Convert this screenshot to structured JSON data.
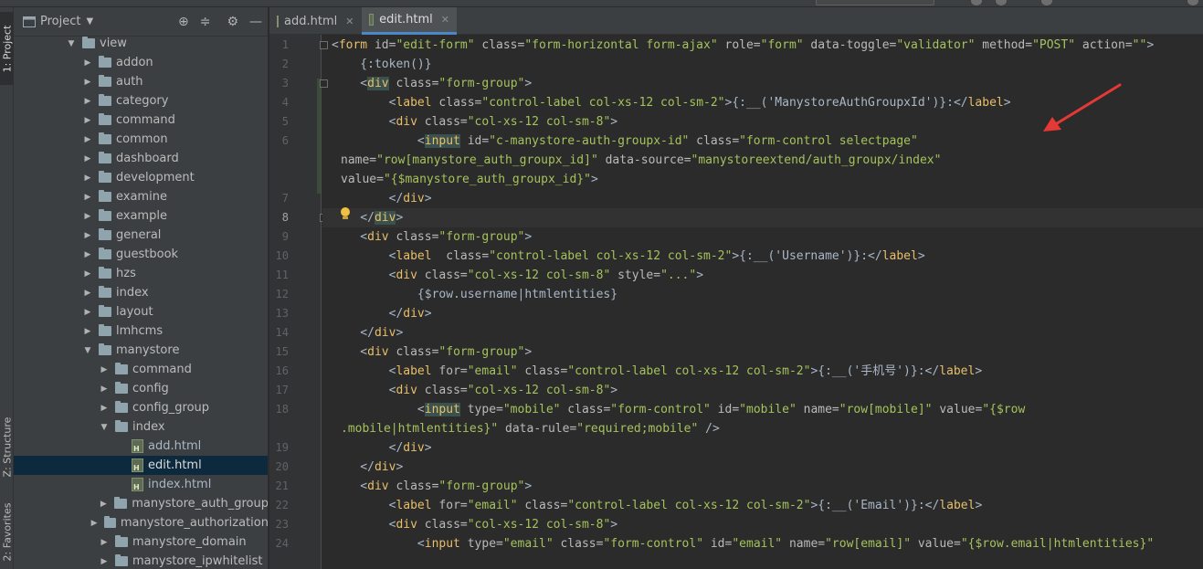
{
  "left_tabs": [
    {
      "label": "1: Project"
    },
    {
      "label": "Z: Structure"
    },
    {
      "label": "2: Favorites"
    }
  ],
  "project": {
    "title": "Project",
    "tree": [
      {
        "label": "view",
        "type": "folder",
        "depth": 0,
        "expanded": true
      },
      {
        "label": "addon",
        "type": "folder",
        "depth": 1
      },
      {
        "label": "auth",
        "type": "folder",
        "depth": 1
      },
      {
        "label": "category",
        "type": "folder",
        "depth": 1
      },
      {
        "label": "command",
        "type": "folder",
        "depth": 1
      },
      {
        "label": "common",
        "type": "folder",
        "depth": 1
      },
      {
        "label": "dashboard",
        "type": "folder",
        "depth": 1
      },
      {
        "label": "development",
        "type": "folder",
        "depth": 1
      },
      {
        "label": "examine",
        "type": "folder",
        "depth": 1
      },
      {
        "label": "example",
        "type": "folder",
        "depth": 1
      },
      {
        "label": "general",
        "type": "folder",
        "depth": 1
      },
      {
        "label": "guestbook",
        "type": "folder",
        "depth": 1
      },
      {
        "label": "hzs",
        "type": "folder",
        "depth": 1
      },
      {
        "label": "index",
        "type": "folder",
        "depth": 1
      },
      {
        "label": "layout",
        "type": "folder",
        "depth": 1
      },
      {
        "label": "lmhcms",
        "type": "folder",
        "depth": 1
      },
      {
        "label": "manystore",
        "type": "folder",
        "depth": 1,
        "expanded": true
      },
      {
        "label": "command",
        "type": "folder",
        "depth": 2
      },
      {
        "label": "config",
        "type": "folder",
        "depth": 2
      },
      {
        "label": "config_group",
        "type": "folder",
        "depth": 2
      },
      {
        "label": "index",
        "type": "folder",
        "depth": 2,
        "expanded": true
      },
      {
        "label": "add.html",
        "type": "file",
        "depth": 3
      },
      {
        "label": "edit.html",
        "type": "file",
        "depth": 3,
        "selected": true
      },
      {
        "label": "index.html",
        "type": "file",
        "depth": 3
      },
      {
        "label": "manystore_auth_group",
        "type": "folder",
        "depth": 2
      },
      {
        "label": "manystore_authorization",
        "type": "folder",
        "depth": 2
      },
      {
        "label": "manystore_domain",
        "type": "folder",
        "depth": 2
      },
      {
        "label": "manystore_ipwhitelist",
        "type": "folder",
        "depth": 2
      }
    ]
  },
  "tabs": [
    {
      "label": "add.html",
      "active": false
    },
    {
      "label": "edit.html",
      "active": true
    }
  ],
  "editor": {
    "current_line": 8,
    "lines": [
      {
        "n": "1",
        "segs": [
          [
            "t-plain",
            "<"
          ],
          [
            "t-tag",
            "form"
          ],
          [
            "t-attr",
            " id="
          ],
          [
            "t-val",
            "\"edit-form\""
          ],
          [
            "t-attr",
            " class="
          ],
          [
            "t-val",
            "\"form-horizontal form-ajax\""
          ],
          [
            "t-attr",
            " role="
          ],
          [
            "t-val",
            "\"form\""
          ],
          [
            "t-attr",
            " data-toggle="
          ],
          [
            "t-val",
            "\"validator\""
          ],
          [
            "t-attr",
            " method="
          ],
          [
            "t-val",
            "\"POST\""
          ],
          [
            "t-attr",
            " action="
          ],
          [
            "t-val",
            "\"\""
          ],
          [
            "t-plain",
            ">"
          ]
        ]
      },
      {
        "n": "2",
        "segs": [
          [
            "t-plain",
            "    {:token()}"
          ]
        ]
      },
      {
        "n": "3",
        "segs": [
          [
            "t-plain",
            "    <"
          ],
          [
            "t-tag t-tagbg",
            "div"
          ],
          [
            "t-attr",
            " class="
          ],
          [
            "t-val",
            "\"form-group\""
          ],
          [
            "t-plain",
            ">"
          ]
        ]
      },
      {
        "n": "4",
        "segs": [
          [
            "t-plain",
            "        <"
          ],
          [
            "t-tag",
            "label"
          ],
          [
            "t-attr",
            " class="
          ],
          [
            "t-val",
            "\"control-label col-xs-12 col-sm-2\""
          ],
          [
            "t-plain",
            ">{:__('ManystoreAuthGroupxId')}:</"
          ],
          [
            "t-tag",
            "label"
          ],
          [
            "t-plain",
            ">"
          ]
        ]
      },
      {
        "n": "5",
        "segs": [
          [
            "t-plain",
            "        <"
          ],
          [
            "t-tag",
            "div"
          ],
          [
            "t-attr",
            " class="
          ],
          [
            "t-val",
            "\"col-xs-12 col-sm-8\""
          ],
          [
            "t-plain",
            ">"
          ]
        ]
      },
      {
        "n": "6",
        "segs": [
          [
            "t-plain",
            "            <"
          ],
          [
            "t-tag t-hl",
            "input"
          ],
          [
            "t-attr",
            " id="
          ],
          [
            "t-val",
            "\"c-manystore-auth-groupx-id\""
          ],
          [
            "t-attr",
            " class="
          ],
          [
            "t-val",
            "\"form-control selectpage\""
          ]
        ]
      },
      {
        "n": "",
        "segs": [
          [
            "t-attr",
            "name="
          ],
          [
            "t-val",
            "\"row[manystore_auth_groupx_id]\""
          ],
          [
            "t-attr",
            " data-source="
          ],
          [
            "t-val",
            "\"manystoreextend/auth_groupx/index\""
          ]
        ]
      },
      {
        "n": "",
        "segs": [
          [
            "t-attr",
            "value="
          ],
          [
            "t-val",
            "\"{$manystore_auth_groupx_id}\""
          ],
          [
            "t-plain",
            ">"
          ]
        ]
      },
      {
        "n": "7",
        "segs": [
          [
            "t-plain",
            "        </"
          ],
          [
            "t-tag",
            "div"
          ],
          [
            "t-plain",
            ">"
          ]
        ]
      },
      {
        "n": "8",
        "segs": [
          [
            "t-plain",
            "    </"
          ],
          [
            "t-tag t-tagbg",
            "div"
          ],
          [
            "t-plain",
            ">"
          ]
        ]
      },
      {
        "n": "9",
        "segs": [
          [
            "t-plain",
            "    <"
          ],
          [
            "t-tag",
            "div"
          ],
          [
            "t-attr",
            " class="
          ],
          [
            "t-val",
            "\"form-group\""
          ],
          [
            "t-plain",
            ">"
          ]
        ]
      },
      {
        "n": "10",
        "segs": [
          [
            "t-plain",
            "        <"
          ],
          [
            "t-tag",
            "label"
          ],
          [
            "t-attr",
            "  class="
          ],
          [
            "t-val",
            "\"control-label col-xs-12 col-sm-2\""
          ],
          [
            "t-plain",
            ">{:__('Username')}:</"
          ],
          [
            "t-tag",
            "label"
          ],
          [
            "t-plain",
            ">"
          ]
        ]
      },
      {
        "n": "11",
        "segs": [
          [
            "t-plain",
            "        <"
          ],
          [
            "t-tag",
            "div"
          ],
          [
            "t-attr",
            " class="
          ],
          [
            "t-val",
            "\"col-xs-12 col-sm-8\""
          ],
          [
            "t-attr",
            " style="
          ],
          [
            "t-val",
            "\"...\""
          ],
          [
            "t-plain",
            ">"
          ]
        ]
      },
      {
        "n": "12",
        "segs": [
          [
            "t-plain",
            "            {$row.username|htmlentities}"
          ]
        ]
      },
      {
        "n": "13",
        "segs": [
          [
            "t-plain",
            "        </"
          ],
          [
            "t-tag",
            "div"
          ],
          [
            "t-plain",
            ">"
          ]
        ]
      },
      {
        "n": "14",
        "segs": [
          [
            "t-plain",
            "    </"
          ],
          [
            "t-tag",
            "div"
          ],
          [
            "t-plain",
            ">"
          ]
        ]
      },
      {
        "n": "15",
        "segs": [
          [
            "t-plain",
            "    <"
          ],
          [
            "t-tag",
            "div"
          ],
          [
            "t-attr",
            " class="
          ],
          [
            "t-val",
            "\"form-group\""
          ],
          [
            "t-plain",
            ">"
          ]
        ]
      },
      {
        "n": "16",
        "segs": [
          [
            "t-plain",
            "        <"
          ],
          [
            "t-tag",
            "label"
          ],
          [
            "t-attr",
            " for="
          ],
          [
            "t-val",
            "\"email\""
          ],
          [
            "t-attr",
            " class="
          ],
          [
            "t-val",
            "\"control-label col-xs-12 col-sm-2\""
          ],
          [
            "t-plain",
            ">{:__('手机号')}:</"
          ],
          [
            "t-tag",
            "label"
          ],
          [
            "t-plain",
            ">"
          ]
        ]
      },
      {
        "n": "17",
        "segs": [
          [
            "t-plain",
            "        <"
          ],
          [
            "t-tag",
            "div"
          ],
          [
            "t-attr",
            " class="
          ],
          [
            "t-val",
            "\"col-xs-12 col-sm-8\""
          ],
          [
            "t-plain",
            ">"
          ]
        ]
      },
      {
        "n": "18",
        "segs": [
          [
            "t-plain",
            "            <"
          ],
          [
            "t-tag t-hl",
            "input"
          ],
          [
            "t-attr",
            " type="
          ],
          [
            "t-val",
            "\"mobile\""
          ],
          [
            "t-attr",
            " class="
          ],
          [
            "t-val",
            "\"form-control\""
          ],
          [
            "t-attr",
            " id="
          ],
          [
            "t-val",
            "\"mobile\""
          ],
          [
            "t-attr",
            " name="
          ],
          [
            "t-val",
            "\"row[mobile]\""
          ],
          [
            "t-attr",
            " value="
          ],
          [
            "t-val",
            "\"{$row"
          ]
        ]
      },
      {
        "n": "",
        "segs": [
          [
            "t-val",
            ".mobile|htmlentities}\""
          ],
          [
            "t-attr",
            " data-rule="
          ],
          [
            "t-val",
            "\"required;mobile\""
          ],
          [
            "t-plain",
            " />"
          ]
        ]
      },
      {
        "n": "19",
        "segs": [
          [
            "t-plain",
            "        </"
          ],
          [
            "t-tag",
            "div"
          ],
          [
            "t-plain",
            ">"
          ]
        ]
      },
      {
        "n": "20",
        "segs": [
          [
            "t-plain",
            "    </"
          ],
          [
            "t-tag",
            "div"
          ],
          [
            "t-plain",
            ">"
          ]
        ]
      },
      {
        "n": "21",
        "segs": [
          [
            "t-plain",
            "    <"
          ],
          [
            "t-tag",
            "div"
          ],
          [
            "t-attr",
            " class="
          ],
          [
            "t-val",
            "\"form-group\""
          ],
          [
            "t-plain",
            ">"
          ]
        ]
      },
      {
        "n": "22",
        "segs": [
          [
            "t-plain",
            "        <"
          ],
          [
            "t-tag",
            "label"
          ],
          [
            "t-attr",
            " for="
          ],
          [
            "t-val",
            "\"email\""
          ],
          [
            "t-attr",
            " class="
          ],
          [
            "t-val",
            "\"control-label col-xs-12 col-sm-2\""
          ],
          [
            "t-plain",
            ">{:__('Email')}:</"
          ],
          [
            "t-tag",
            "label"
          ],
          [
            "t-plain",
            ">"
          ]
        ]
      },
      {
        "n": "23",
        "segs": [
          [
            "t-plain",
            "        <"
          ],
          [
            "t-tag",
            "div"
          ],
          [
            "t-attr",
            " class="
          ],
          [
            "t-val",
            "\"col-xs-12 col-sm-8\""
          ],
          [
            "t-plain",
            ">"
          ]
        ]
      },
      {
        "n": "24",
        "segs": [
          [
            "t-plain",
            "            <"
          ],
          [
            "t-tag",
            "input"
          ],
          [
            "t-attr",
            " type="
          ],
          [
            "t-val",
            "\"email\""
          ],
          [
            "t-attr",
            " class="
          ],
          [
            "t-val",
            "\"form-control\""
          ],
          [
            "t-attr",
            " id="
          ],
          [
            "t-val",
            "\"email\""
          ],
          [
            "t-attr",
            " name="
          ],
          [
            "t-val",
            "\"row[email]\""
          ],
          [
            "t-attr",
            " value="
          ],
          [
            "t-val",
            "\"{$row.email|htmlentities}\""
          ]
        ]
      }
    ]
  },
  "colors": {
    "tag": "#e8bf6a",
    "value": "#a5c25c",
    "attr": "#bababa",
    "selection": "#0d293e",
    "annotation_arrow": "#e53935"
  }
}
